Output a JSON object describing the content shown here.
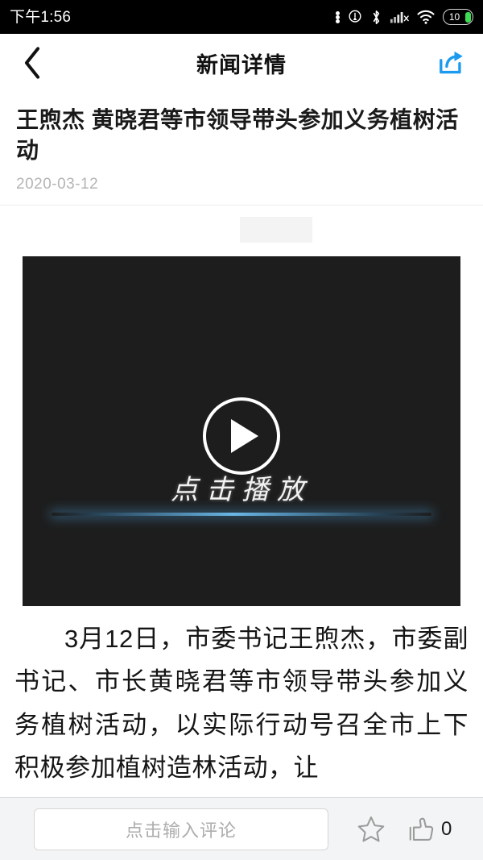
{
  "status_bar": {
    "time": "下午1:56",
    "battery_percent": "10",
    "icons": [
      "more-dots-icon",
      "location-icon",
      "bluetooth-icon",
      "cellular-signal-icon",
      "wifi-icon",
      "battery-icon"
    ]
  },
  "nav": {
    "title": "新闻详情",
    "back_icon": "back-chevron-icon",
    "share_icon": "share-icon",
    "share_color": "#1a9bf0"
  },
  "article": {
    "title": "王煦杰 黄晓君等市领导带头参加义务植树活动",
    "date": "2020-03-12",
    "body": "3月12日，市委书记王煦杰，市委副书记、市长黄晓君等市领导带头参加义务植树活动，以实际行动号召全市上下积极参加植树造林活动，让"
  },
  "video": {
    "play_label": "点击播放",
    "play_icon": "play-button-icon",
    "background_color": "#1d1d1d",
    "glow_color": "#6ebef0"
  },
  "bottom_bar": {
    "comment_placeholder": "点击输入评论",
    "favorite_icon": "star-outline-icon",
    "like_icon": "thumbs-up-outline-icon",
    "like_count": "0"
  }
}
